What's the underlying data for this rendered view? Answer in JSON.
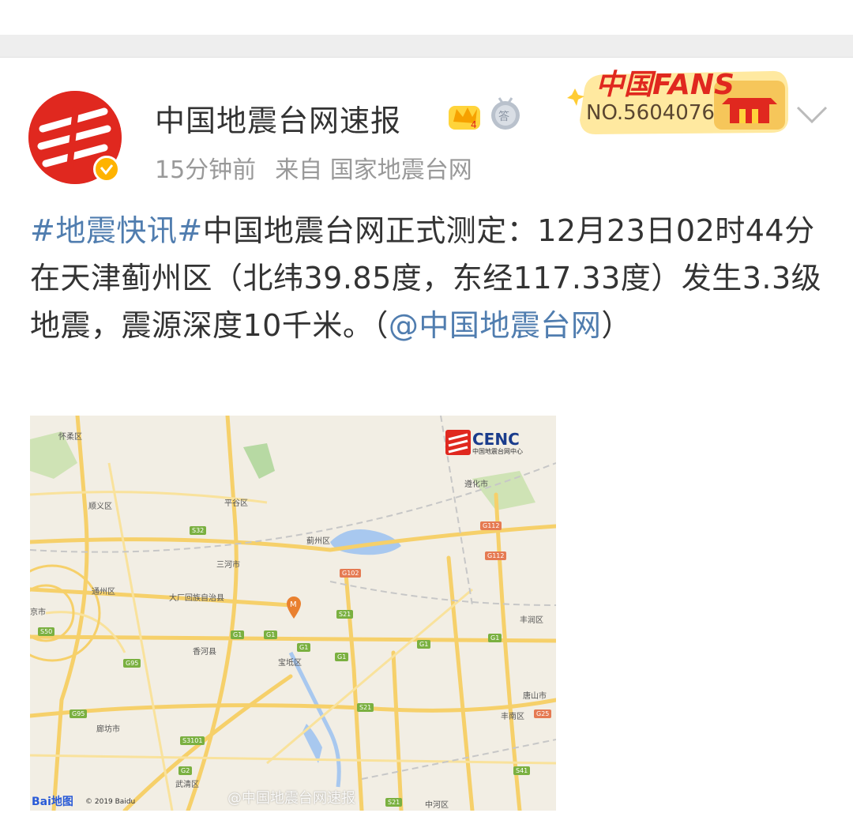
{
  "post": {
    "username": "中国地震台网速报",
    "time": "15分钟前",
    "source": "来自 国家地震台网",
    "fans_badge": {
      "title": "中国FANS",
      "number": "NO.5604076"
    },
    "text": {
      "hashtag": "#地震快讯#",
      "body": "中国地震台网正式测定：12月23日02时44分在天津蓟州区（北纬39.85度，东经117.33度）发生3.3级地震，震源深度10千米。（",
      "mention": "@中国地震台网",
      "tail": "）"
    }
  },
  "map": {
    "logo_text": "CENC",
    "logo_subtext": "中国地震台网中心",
    "watermark": "@中国地震台网速报",
    "baidu": "Bai地图",
    "copyright": "© 2019 Baidu",
    "marker": "M",
    "labels": [
      "怀柔区",
      "顺义区",
      "平谷区",
      "三河市",
      "蓟州区",
      "通州区",
      "大厂回族自治县",
      "香河县",
      "宝坻区",
      "廊坊市",
      "武清区",
      "遵化市",
      "丰润区",
      "唐山市",
      "丰南区",
      "京市",
      "中河区"
    ],
    "shields": [
      "S32",
      "G1",
      "G1",
      "G1",
      "G1",
      "G1",
      "G1",
      "S21",
      "S21",
      "G95",
      "G95",
      "S50",
      "S3101",
      "G2",
      "G112",
      "G112",
      "G102",
      "S41",
      "S21",
      "G25"
    ]
  }
}
